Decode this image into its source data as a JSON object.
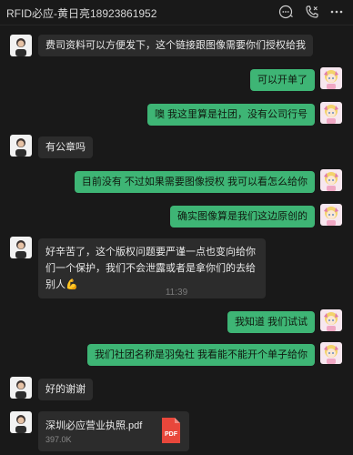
{
  "header": {
    "title": "RFID必应-黄日亮18923861952",
    "icons": [
      "chat-bubble-more-icon",
      "phone-icon",
      "more-icon"
    ]
  },
  "messages": [
    {
      "side": "in",
      "text": "费司资料可以方便发下，这个链接跟图像需要你们授权给我"
    },
    {
      "side": "out",
      "text": "可以开单了"
    },
    {
      "side": "out",
      "text": "噢 我这里算是社团，没有公司行号"
    },
    {
      "side": "in",
      "text": "有公章吗"
    },
    {
      "side": "out",
      "text": "目前没有 不过如果需要图像授权 我可以看怎么给你"
    },
    {
      "side": "out",
      "text": "确实图像算是我们这边原创的"
    },
    {
      "side": "in",
      "text": "好辛苦了，这个版权问题要严谨一点也变向给你们一个保护，我们不会泄露或者是拿你们的去给别人💪"
    },
    {
      "side": "out",
      "text": "我知道 我们试试"
    },
    {
      "side": "out",
      "text": "我们社团名称是羽兔社 我看能不能开个单子给你"
    },
    {
      "side": "in",
      "text": "好的谢谢"
    }
  ],
  "timestamp": "11:39",
  "file": {
    "name": "深圳必应营业执照.pdf",
    "size": "397.0K",
    "badge": "PDF",
    "badge_color": "#e8473b"
  },
  "colors": {
    "background": "#191919",
    "incoming_bubble": "#2c2c2c",
    "outgoing_bubble": "#3eb575"
  }
}
